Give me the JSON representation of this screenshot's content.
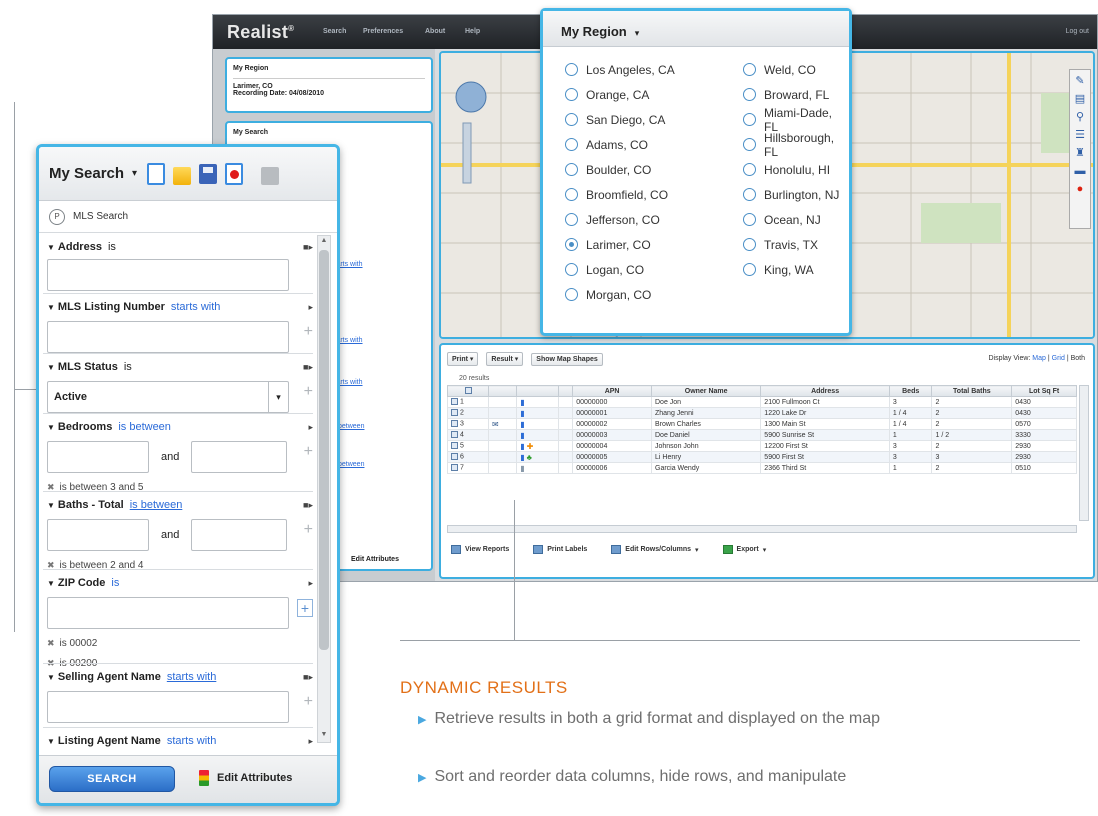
{
  "app": {
    "logo": "Realist",
    "logo_mark": "®",
    "nav": [
      "Search",
      "Preferences",
      "About",
      "Help"
    ],
    "signout": "Log out"
  },
  "bg_left": {
    "region_label": "My Region",
    "region_value": "Larimer, CO",
    "recording_date": "Recording Date: 04/08/2010",
    "my_search": "My Search",
    "starts_with": "starts with",
    "is_between": "is between",
    "edit_attributes": "Edit Attributes"
  },
  "region_popup": {
    "title": "My Region",
    "left": [
      {
        "label": "Los Angeles, CA",
        "selected": false
      },
      {
        "label": "Orange, CA",
        "selected": false
      },
      {
        "label": "San Diego, CA",
        "selected": false
      },
      {
        "label": "Adams, CO",
        "selected": false
      },
      {
        "label": "Boulder, CO",
        "selected": false
      },
      {
        "label": "Broomfield, CO",
        "selected": false
      },
      {
        "label": "Jefferson, CO",
        "selected": false
      },
      {
        "label": "Larimer, CO",
        "selected": true
      },
      {
        "label": "Logan, CO",
        "selected": false
      },
      {
        "label": "Morgan, CO",
        "selected": false
      }
    ],
    "right": [
      {
        "label": "Weld, CO",
        "selected": false
      },
      {
        "label": "Broward, FL",
        "selected": false
      },
      {
        "label": "Miami-Dade, FL",
        "selected": false
      },
      {
        "label": "Hillsborough, FL",
        "selected": false
      },
      {
        "label": "Honolulu, HI",
        "selected": false
      },
      {
        "label": "Burlington, NJ",
        "selected": false
      },
      {
        "label": "Ocean, NJ",
        "selected": false
      },
      {
        "label": "Travis, TX",
        "selected": false
      },
      {
        "label": "King, WA",
        "selected": false
      }
    ]
  },
  "grid": {
    "print": "Print",
    "result": "Result",
    "show_map_shapes": "Show Map Shapes",
    "display_view_label": "Display View:",
    "view_map": "Map",
    "view_grid": "Grid",
    "view_both": "Both",
    "result_count": "20 results",
    "columns": [
      "",
      "",
      "",
      "",
      "APN",
      "Owner Name",
      "Address",
      "Beds",
      "Total Baths",
      "Lot Sq Ft"
    ],
    "rows": [
      {
        "n": "1",
        "apn": "00000000",
        "owner": "Doe Jon",
        "addr": "2100 Fullmoon Ct",
        "beds": "3",
        "baths": "2",
        "lot": "0430",
        "icons": [
          "b"
        ]
      },
      {
        "n": "2",
        "apn": "00000001",
        "owner": "Zhang Jenni",
        "addr": "1220 Lake Dr",
        "beds": "1 / 4",
        "baths": "2",
        "lot": "0430",
        "icons": [
          "b"
        ]
      },
      {
        "n": "3",
        "apn": "00000002",
        "owner": "Brown Charles",
        "addr": "1300 Main St",
        "beds": "1 / 4",
        "baths": "2",
        "lot": "0570",
        "icons": [
          "m",
          "b"
        ]
      },
      {
        "n": "4",
        "apn": "00000003",
        "owner": "Doe Daniel",
        "addr": "5900 Sunrise St",
        "beds": "1",
        "baths": "1 / 2",
        "lot": "3330",
        "icons": [
          "b"
        ]
      },
      {
        "n": "5",
        "apn": "00000004",
        "owner": "Johnson John",
        "addr": "12200 First St",
        "beds": "3",
        "baths": "2",
        "lot": "2930",
        "icons": [
          "b",
          "o"
        ]
      },
      {
        "n": "6",
        "apn": "00000005",
        "owner": "Li Henry",
        "addr": "5900 First St",
        "beds": "3",
        "baths": "3",
        "lot": "2930",
        "icons": [
          "b",
          "g"
        ]
      },
      {
        "n": "7",
        "apn": "00000006",
        "owner": "Garcia Wendy",
        "addr": "2366 Third St",
        "beds": "1",
        "baths": "2",
        "lot": "0510",
        "icons": [
          "g2"
        ]
      }
    ],
    "bottom": [
      "View Reports",
      "Print Labels",
      "Edit Rows/Columns",
      "Export"
    ]
  },
  "search_panel": {
    "title": "My Search",
    "mls_search": "MLS Search",
    "sections": {
      "address": {
        "label": "Address",
        "op": "is"
      },
      "mls_number": {
        "label": "MLS Listing Number",
        "op": "starts with"
      },
      "mls_status": {
        "label": "MLS Status",
        "op": "is",
        "value": "Active"
      },
      "bedrooms": {
        "label": "Bedrooms",
        "op": "is between",
        "and": "and",
        "criteria": "is between 3 and 5"
      },
      "baths": {
        "label": "Baths - Total",
        "op": "is between",
        "and": "and",
        "criteria": "is between 2 and 4"
      },
      "zip": {
        "label": "ZIP Code",
        "op": "is",
        "criteria": [
          "is 00002",
          "is 00200"
        ]
      },
      "selling_agent": {
        "label": "Selling Agent Name",
        "op": "starts with"
      },
      "listing_agent": {
        "label": "Listing Agent Name",
        "op": "starts with"
      }
    },
    "search_button": "SEARCH",
    "edit_attributes": "Edit Attributes"
  },
  "callout": {
    "title": "DYNAMIC RESULTS",
    "bullets": [
      "Retrieve results in both a grid format and displayed on the map",
      "Sort and reorder data columns, hide rows, and manipulate"
    ]
  }
}
